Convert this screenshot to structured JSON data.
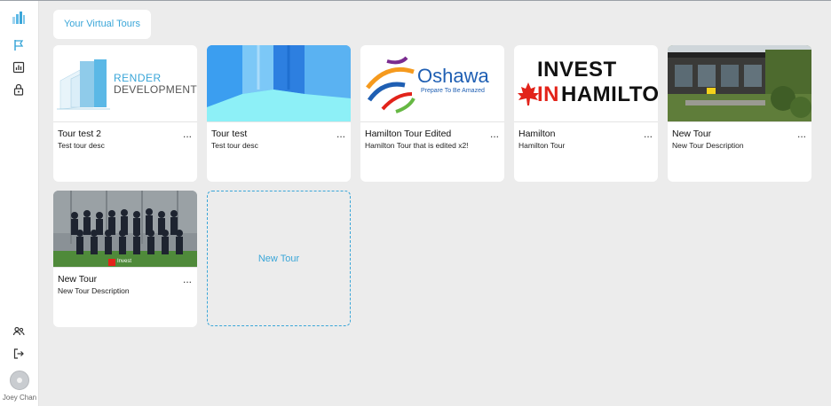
{
  "header": {
    "title": "Your Virtual Tours"
  },
  "sidebar": {
    "top_icons": [
      "logo-icon",
      "flag-icon",
      "chart-icon",
      "lock-icon"
    ],
    "bottom_icons": [
      "users-icon",
      "logout-icon"
    ],
    "user": {
      "name": "Joey Chan"
    }
  },
  "tours": [
    {
      "title": "Tour test 2",
      "description": "Test tour desc",
      "menu": "...",
      "logo_text": [
        "RENDER",
        "DEVELOPMENTS"
      ]
    },
    {
      "title": "Tour test",
      "description": "Test tour desc",
      "menu": "..."
    },
    {
      "title": "Hamilton Tour Edited",
      "description": "Hamilton Tour that is edited x2!",
      "menu": "...",
      "logo_text": [
        "Oshawa",
        "Prepare To Be Amazed"
      ]
    },
    {
      "title": "Hamilton",
      "description": "Hamilton Tour",
      "menu": "...",
      "logo_text": [
        "INVEST",
        "IN",
        "HAMILTON"
      ]
    },
    {
      "title": "New Tour",
      "description": "New Tour Description",
      "menu": "..."
    },
    {
      "title": "New Tour",
      "description": "New Tour Description",
      "menu": "...",
      "logo_text": [
        "Invest"
      ]
    }
  ],
  "new_tour": {
    "label": "New Tour"
  },
  "colors": {
    "accent": "#3aa6d8",
    "background": "#ececec",
    "card": "#ffffff"
  }
}
